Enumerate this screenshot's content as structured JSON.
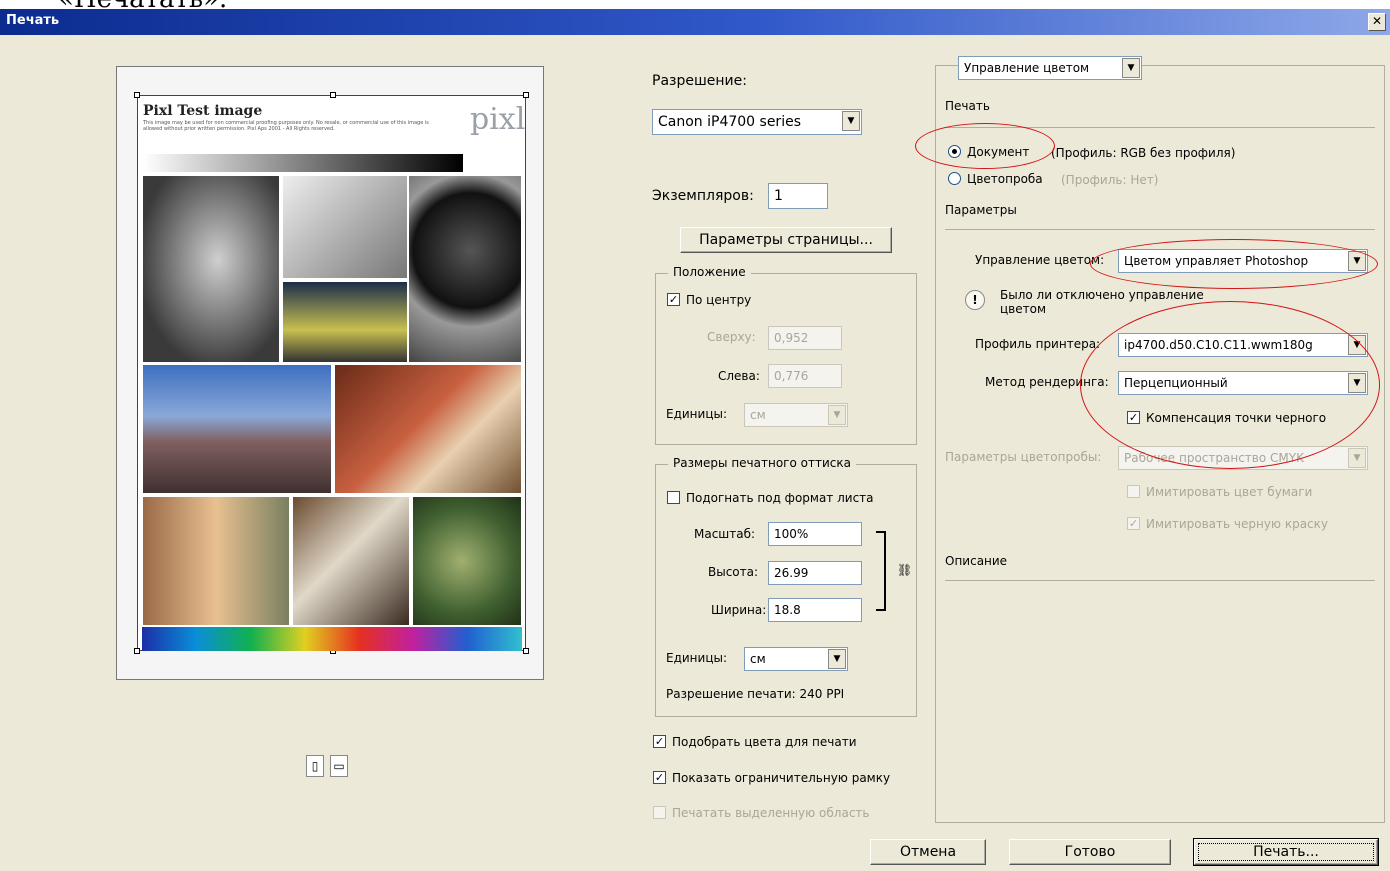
{
  "page_top_text": "«Печатать».",
  "window": {
    "title": "Печать",
    "close_label": "✕"
  },
  "preview": {
    "image_title": "Pixl Test image",
    "fine_print": "This image may be used for non commercial proofing purposes only. No resale, or commercial use of this image is allowed without prior written permission. Pixl Aps 2001 - All Rights reserved.",
    "logo": "pixl"
  },
  "printer": {
    "label": "Разрешение:",
    "selected": "Canon iP4700 series",
    "copies_label": "Экземпляров:",
    "copies_value": "1",
    "page_setup_button": "Параметры страницы..."
  },
  "position": {
    "title": "Положение",
    "center_label": "По центру",
    "center_checked": true,
    "top_label": "Сверху:",
    "top_value": "0,952",
    "left_label": "Слева:",
    "left_value": "0,776",
    "units_label": "Единицы:",
    "units_value": "см"
  },
  "print_size": {
    "title": "Размеры печатного оттиска",
    "fit_label": "Подогнать под формат листа",
    "fit_checked": false,
    "scale_label": "Масштаб:",
    "scale_value": "100%",
    "height_label": "Высота:",
    "height_value": "26.99",
    "width_label": "Ширина:",
    "width_value": "18.8",
    "units_label": "Единицы:",
    "units_value": "см",
    "resolution_text": "Разрешение печати: 240 PPI"
  },
  "options": {
    "match_colors_label": "Подобрать цвета для печати",
    "match_colors_checked": true,
    "bounding_box_label": "Показать ограничительную рамку",
    "bounding_box_checked": true,
    "print_selection_label": "Печатать выделенную область",
    "print_selection_checked": false
  },
  "color_panel": {
    "dropdown_value": "Управление цветом",
    "print_heading": "Печать",
    "document_label": "Документ",
    "document_profile": "(Профиль: RGB без профиля)",
    "proof_label": "Цветопроба",
    "proof_profile": "(Профиль: Нет)",
    "params_heading": "Параметры",
    "cm_label": "Управление цветом:",
    "cm_value": "Цветом управляет Photoshop",
    "warning_text": "Было ли отключено управление цветом",
    "printer_profile_label": "Профиль принтера:",
    "printer_profile_value": "ip4700.d50.C10.C11.wwm180g",
    "render_method_label": "Метод рендеринга:",
    "render_method_value": "Перцепционный",
    "bpc_label": "Компенсация точки черного",
    "bpc_checked": true,
    "proof_setup_label": "Параметры цветопробы:",
    "proof_setup_value": "Рабочее пространство CMYK",
    "sim_paper_label": "Имитировать цвет бумаги",
    "sim_ink_label": "Имитировать черную краску",
    "description_heading": "Описание"
  },
  "buttons": {
    "cancel": "Отмена",
    "done": "Готово",
    "print": "Печать..."
  },
  "annotation_color": "#d21414",
  "title_bar_color": "#0b2b8f"
}
